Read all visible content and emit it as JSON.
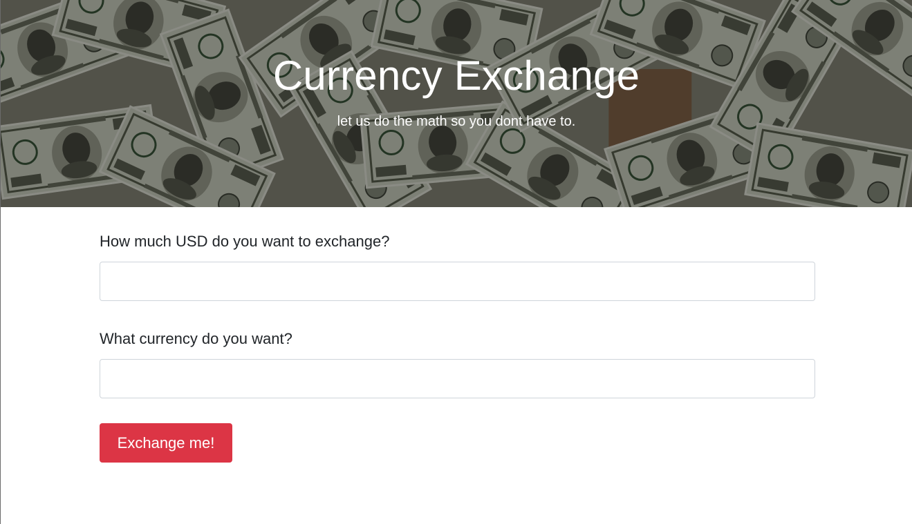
{
  "hero": {
    "title": "Currency Exchange",
    "subtitle": "let us do the math so you dont have to."
  },
  "form": {
    "usd_label": "How much USD do you want to exchange?",
    "usd_value": "",
    "currency_label": "What currency do you want?",
    "currency_value": "",
    "submit_label": "Exchange me!"
  },
  "colors": {
    "button": "#dc3545",
    "text": "#212529",
    "input_border": "#ced4da"
  }
}
